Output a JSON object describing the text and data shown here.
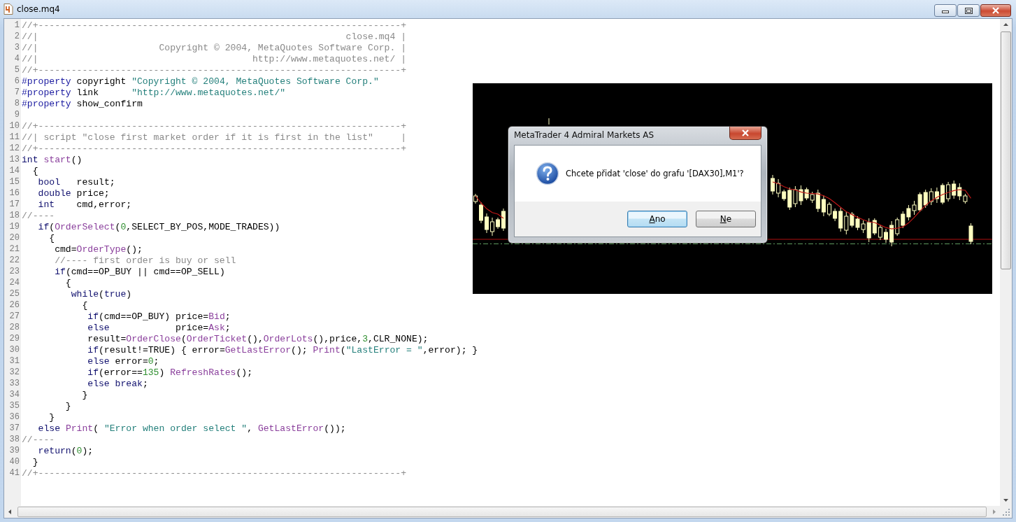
{
  "window": {
    "title": "close.mq4"
  },
  "editor": {
    "lines": [
      {
        "number": "1",
        "tokens": [
          {
            "kind": "comment",
            "text": "//+------------------------------------------------------------------+"
          }
        ]
      },
      {
        "number": "2",
        "tokens": [
          {
            "kind": "comment",
            "text": "//|                                                        close.mq4 |"
          }
        ]
      },
      {
        "number": "3",
        "tokens": [
          {
            "kind": "comment",
            "text": "//|                      Copyright © 2004, MetaQuotes Software Corp. |"
          }
        ]
      },
      {
        "number": "4",
        "tokens": [
          {
            "kind": "comment",
            "text": "//|                                       http://www.metaquotes.net/ |"
          }
        ]
      },
      {
        "number": "5",
        "tokens": [
          {
            "kind": "comment",
            "text": "//+------------------------------------------------------------------+"
          }
        ]
      },
      {
        "number": "6",
        "tokens": [
          {
            "kind": "directive",
            "text": "#property"
          },
          {
            "kind": "plain",
            "text": " copyright "
          },
          {
            "kind": "string",
            "text": "\"Copyright © 2004, MetaQuotes Software Corp.\""
          }
        ]
      },
      {
        "number": "7",
        "tokens": [
          {
            "kind": "directive",
            "text": "#property"
          },
          {
            "kind": "plain",
            "text": " link      "
          },
          {
            "kind": "string",
            "text": "\"http://www.metaquotes.net/\""
          }
        ]
      },
      {
        "number": "8",
        "tokens": [
          {
            "kind": "directive",
            "text": "#property"
          },
          {
            "kind": "plain",
            "text": " show_confirm"
          }
        ]
      },
      {
        "number": "9"
      },
      {
        "number": "10",
        "tokens": [
          {
            "kind": "comment",
            "text": "//+------------------------------------------------------------------+"
          }
        ]
      },
      {
        "number": "11",
        "tokens": [
          {
            "kind": "comment",
            "text": "//| script \"close first market order if it is first in the list\"     |"
          }
        ]
      },
      {
        "number": "12",
        "tokens": [
          {
            "kind": "comment",
            "text": "//+------------------------------------------------------------------+"
          }
        ]
      },
      {
        "number": "13",
        "tokens": [
          {
            "kind": "keyword",
            "text": "int "
          },
          {
            "kind": "function",
            "text": "start"
          },
          {
            "kind": "plain",
            "text": "()"
          }
        ]
      },
      {
        "number": "14",
        "tokens": [
          {
            "kind": "plain",
            "text": "  {"
          }
        ]
      },
      {
        "number": "15",
        "tokens": [
          {
            "kind": "keyword",
            "text": "   bool"
          },
          {
            "kind": "plain",
            "text": "   result;"
          }
        ]
      },
      {
        "number": "16",
        "tokens": [
          {
            "kind": "keyword",
            "text": "   double"
          },
          {
            "kind": "plain",
            "text": " price;"
          }
        ]
      },
      {
        "number": "17",
        "tokens": [
          {
            "kind": "keyword",
            "text": "   int"
          },
          {
            "kind": "plain",
            "text": "    cmd,error;"
          }
        ]
      },
      {
        "number": "18",
        "tokens": [
          {
            "kind": "comment",
            "text": "//----"
          }
        ]
      },
      {
        "number": "19",
        "tokens": [
          {
            "kind": "keyword",
            "text": "   if"
          },
          {
            "kind": "plain",
            "text": "("
          },
          {
            "kind": "function",
            "text": "OrderSelect"
          },
          {
            "kind": "plain",
            "text": "("
          },
          {
            "kind": "number",
            "text": "0"
          },
          {
            "kind": "plain",
            "text": ",SELECT_BY_POS,MODE_TRADES))"
          }
        ]
      },
      {
        "number": "20",
        "tokens": [
          {
            "kind": "plain",
            "text": "     {"
          }
        ]
      },
      {
        "number": "21",
        "tokens": [
          {
            "kind": "plain",
            "text": "      cmd="
          },
          {
            "kind": "function",
            "text": "OrderType"
          },
          {
            "kind": "plain",
            "text": "();"
          }
        ]
      },
      {
        "number": "22",
        "tokens": [
          {
            "kind": "comment",
            "text": "      //---- first order is buy or sell"
          }
        ]
      },
      {
        "number": "23",
        "tokens": [
          {
            "kind": "keyword",
            "text": "      if"
          },
          {
            "kind": "plain",
            "text": "(cmd==OP_BUY || cmd==OP_SELL)"
          }
        ]
      },
      {
        "number": "24",
        "tokens": [
          {
            "kind": "plain",
            "text": "        {"
          }
        ]
      },
      {
        "number": "25",
        "tokens": [
          {
            "kind": "keyword",
            "text": "         while"
          },
          {
            "kind": "plain",
            "text": "("
          },
          {
            "kind": "keyword",
            "text": "true"
          },
          {
            "kind": "plain",
            "text": ")"
          }
        ]
      },
      {
        "number": "26",
        "tokens": [
          {
            "kind": "plain",
            "text": "           {"
          }
        ]
      },
      {
        "number": "27",
        "tokens": [
          {
            "kind": "keyword",
            "text": "            if"
          },
          {
            "kind": "plain",
            "text": "(cmd==OP_BUY) price="
          },
          {
            "kind": "function",
            "text": "Bid"
          },
          {
            "kind": "plain",
            "text": ";"
          }
        ]
      },
      {
        "number": "28",
        "tokens": [
          {
            "kind": "keyword",
            "text": "            else"
          },
          {
            "kind": "plain",
            "text": "            price="
          },
          {
            "kind": "function",
            "text": "Ask"
          },
          {
            "kind": "plain",
            "text": ";"
          }
        ]
      },
      {
        "number": "29",
        "tokens": [
          {
            "kind": "plain",
            "text": "            result="
          },
          {
            "kind": "function",
            "text": "OrderClose"
          },
          {
            "kind": "plain",
            "text": "("
          },
          {
            "kind": "function",
            "text": "OrderTicket"
          },
          {
            "kind": "plain",
            "text": "(),"
          },
          {
            "kind": "function",
            "text": "OrderLots"
          },
          {
            "kind": "plain",
            "text": "(),price,"
          },
          {
            "kind": "number",
            "text": "3"
          },
          {
            "kind": "plain",
            "text": ",CLR_NONE);"
          }
        ]
      },
      {
        "number": "30",
        "tokens": [
          {
            "kind": "keyword",
            "text": "            if"
          },
          {
            "kind": "plain",
            "text": "(result!=TRUE) { error="
          },
          {
            "kind": "function",
            "text": "GetLastError"
          },
          {
            "kind": "plain",
            "text": "(); "
          },
          {
            "kind": "function",
            "text": "Print"
          },
          {
            "kind": "plain",
            "text": "("
          },
          {
            "kind": "string",
            "text": "\"LastError = \""
          },
          {
            "kind": "plain",
            "text": ",error); }"
          }
        ]
      },
      {
        "number": "31",
        "tokens": [
          {
            "kind": "keyword",
            "text": "            else"
          },
          {
            "kind": "plain",
            "text": " error="
          },
          {
            "kind": "number",
            "text": "0"
          },
          {
            "kind": "plain",
            "text": ";"
          }
        ]
      },
      {
        "number": "32",
        "tokens": [
          {
            "kind": "keyword",
            "text": "            if"
          },
          {
            "kind": "plain",
            "text": "(error=="
          },
          {
            "kind": "number",
            "text": "135"
          },
          {
            "kind": "plain",
            "text": ") "
          },
          {
            "kind": "function",
            "text": "RefreshRates"
          },
          {
            "kind": "plain",
            "text": "();"
          }
        ]
      },
      {
        "number": "33",
        "tokens": [
          {
            "kind": "keyword",
            "text": "            else break"
          },
          {
            "kind": "plain",
            "text": ";"
          }
        ]
      },
      {
        "number": "34",
        "tokens": [
          {
            "kind": "plain",
            "text": "           }"
          }
        ]
      },
      {
        "number": "35",
        "tokens": [
          {
            "kind": "plain",
            "text": "        }"
          }
        ]
      },
      {
        "number": "36",
        "tokens": [
          {
            "kind": "plain",
            "text": "     }"
          }
        ]
      },
      {
        "number": "37",
        "tokens": [
          {
            "kind": "keyword",
            "text": "   else "
          },
          {
            "kind": "function",
            "text": "Print"
          },
          {
            "kind": "plain",
            "text": "( "
          },
          {
            "kind": "string",
            "text": "\"Error when order select \""
          },
          {
            "kind": "plain",
            "text": ", "
          },
          {
            "kind": "function",
            "text": "GetLastError"
          },
          {
            "kind": "plain",
            "text": "());"
          }
        ]
      },
      {
        "number": "38",
        "tokens": [
          {
            "kind": "comment",
            "text": "//----"
          }
        ]
      },
      {
        "number": "39",
        "tokens": [
          {
            "kind": "keyword",
            "text": "   return"
          },
          {
            "kind": "plain",
            "text": "("
          },
          {
            "kind": "number",
            "text": "0"
          },
          {
            "kind": "plain",
            "text": ");"
          }
        ]
      },
      {
        "number": "40",
        "tokens": [
          {
            "kind": "plain",
            "text": "  }"
          }
        ]
      },
      {
        "number": "41",
        "tokens": [
          {
            "kind": "comment",
            "text": "//+------------------------------------------------------------------+"
          }
        ]
      }
    ]
  },
  "dialog": {
    "title": "MetaTrader 4 Admiral Markets AS",
    "message": "Chcete přidat 'close' do grafu '[DAX30],M1'?",
    "buttons": [
      {
        "label": "Ano",
        "default": true,
        "mnemonic_underlined": true
      },
      {
        "label": "Ne",
        "default": false,
        "mnemonic_underlined": true
      }
    ]
  }
}
